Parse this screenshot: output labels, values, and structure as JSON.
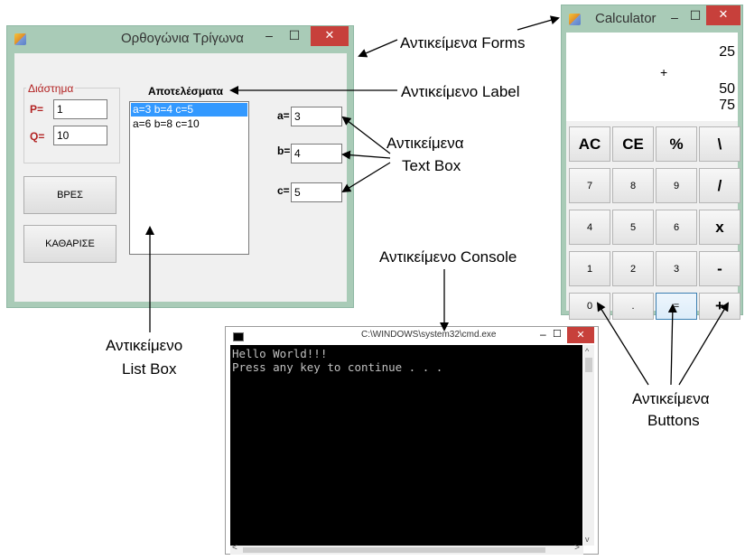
{
  "forms_window": {
    "title": "Ορθογώνια Τρίγωνα",
    "minimize": "–",
    "maximize": "☐",
    "close": "✕",
    "group_label": "Διάστημα",
    "p_label": "P=",
    "p_value": "1",
    "q_label": "Q=",
    "q_value": "10",
    "results_label": "Αποτελέσματα",
    "results_items": [
      "a=3 b=4 c=5",
      "a=6 b=8 c=10"
    ],
    "a_label": "a=",
    "a_value": "3",
    "b_label": "b=",
    "b_value": "4",
    "c_label": "c=",
    "c_value": "5",
    "find_button": "ΒΡΕΣ",
    "clear_button": "ΚΑΘΑΡΙΣΕ"
  },
  "calculator": {
    "title": "Calculator",
    "minimize": "–",
    "maximize": "☐",
    "close": "✕",
    "display_line1": "25",
    "display_op": "+",
    "display_line2": "50",
    "display_result": "75",
    "buttons": [
      "AC",
      "CE",
      "%",
      "\\",
      "7",
      "8",
      "9",
      "/",
      "4",
      "5",
      "6",
      "x",
      "1",
      "2",
      "3",
      "-",
      "0",
      ".",
      "=",
      "+"
    ]
  },
  "console": {
    "title": "C:\\WINDOWS\\system32\\cmd.exe",
    "line1": "Hello World!!!",
    "line2": "Press any key to continue . . .",
    "scroll_up": "^",
    "scroll_down": "v",
    "scroll_left": "<",
    "scroll_right": ">"
  },
  "annotations": {
    "forms": "Αντικείμενα Forms",
    "label": "Αντικείμενο Label",
    "textbox_1": "Αντικείμενα",
    "textbox_2": "Text Box",
    "console": "Αντικείμενο Console",
    "listbox_1": "Αντικείμενο",
    "listbox_2": "List Box",
    "buttons_1": "Αντικείμενα",
    "buttons_2": "Buttons"
  },
  "colors": {
    "window_frame": "#a9cbb7",
    "close_button": "#c7403b",
    "group_label": "#b22222",
    "selection": "#3399ff"
  }
}
